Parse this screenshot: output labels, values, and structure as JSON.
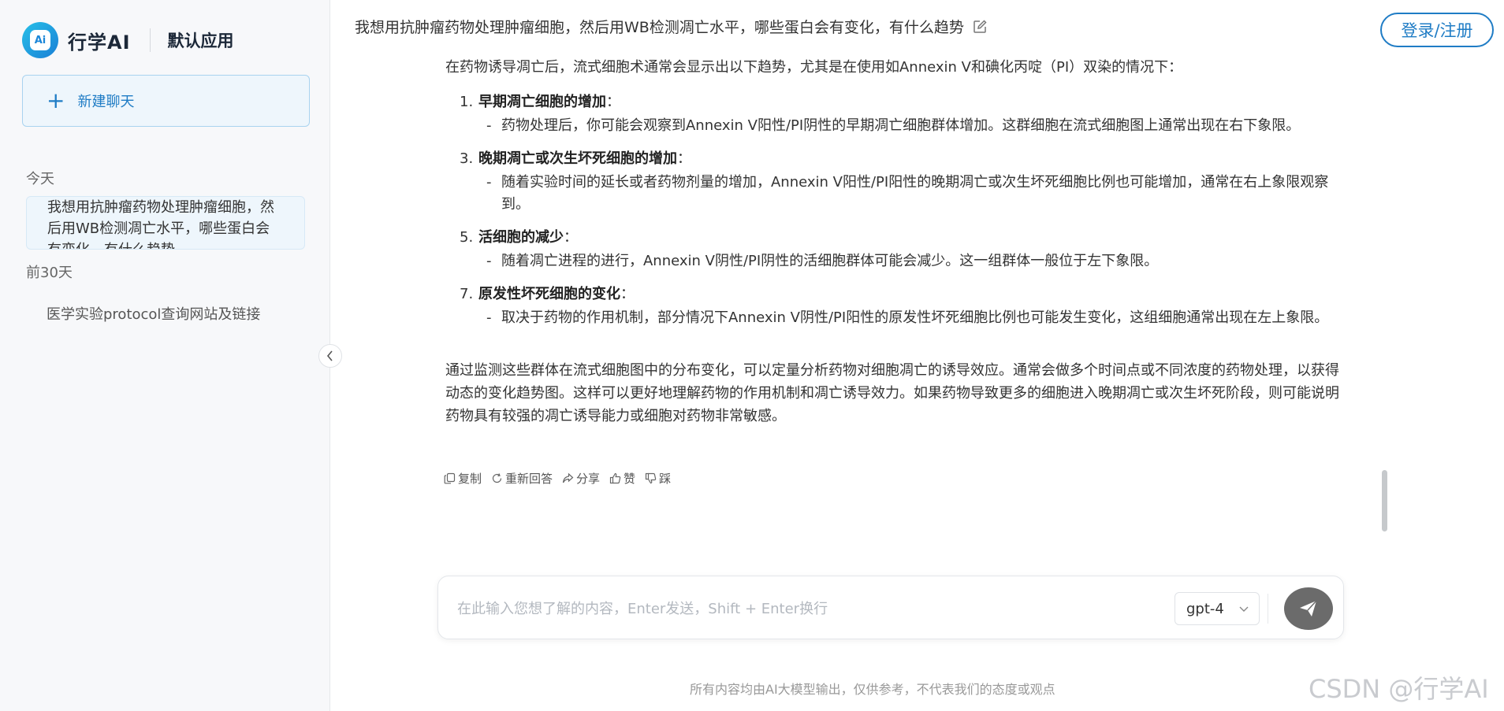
{
  "brand": {
    "logo_text": "Ai",
    "name": "行学AI",
    "app_name": "默认应用"
  },
  "sidebar": {
    "new_chat_label": "新建聊天",
    "groups": [
      {
        "label": "今天",
        "items": [
          "我想用抗肿瘤药物处理肿瘤细胞，然后用WB检测凋亡水平，哪些蛋白会有变化，有什么趋势"
        ]
      },
      {
        "label": "前30天",
        "items": [
          "医学实验protocol查询网站及链接"
        ]
      }
    ]
  },
  "header": {
    "question": "我想用抗肿瘤药物处理肿瘤细胞，然后用WB检测凋亡水平，哪些蛋白会有变化，有什么趋势",
    "login_label": "登录/注册"
  },
  "answer": {
    "intro": "在药物诱导凋亡后，流式细胞术通常会显示出以下趋势，尤其是在使用如Annexin V和碘化丙啶（PI）双染的情况下：",
    "points": [
      {
        "num": "1.",
        "title": "早期凋亡细胞的增加",
        "colon": "：",
        "dash": "-",
        "body": "药物处理后，你可能会观察到Annexin V阳性/PI阴性的早期凋亡细胞群体增加。这群细胞在流式细胞图上通常出现在右下象限。"
      },
      {
        "num": "3.",
        "title": "晚期凋亡或次生坏死细胞的增加",
        "colon": "：",
        "dash": "-",
        "body": "随着实验时间的延长或者药物剂量的增加，Annexin V阳性/PI阳性的晚期凋亡或次生坏死细胞比例也可能增加，通常在右上象限观察到。"
      },
      {
        "num": "5.",
        "title": "活细胞的减少",
        "colon": "：",
        "dash": "-",
        "body": "随着凋亡进程的进行，Annexin V阴性/PI阴性的活细胞群体可能会减少。这一组群体一般位于左下象限。"
      },
      {
        "num": "7.",
        "title": "原发性坏死细胞的变化",
        "colon": "：",
        "dash": "-",
        "body": "取决于药物的作用机制，部分情况下Annexin V阴性/PI阳性的原发性坏死细胞比例也可能发生变化，这组细胞通常出现在左上象限。"
      }
    ],
    "conclusion": "通过监测这些群体在流式细胞图中的分布变化，可以定量分析药物对细胞凋亡的诱导效应。通常会做多个时间点或不同浓度的药物处理，以获得动态的变化趋势图。这样可以更好地理解药物的作用机制和凋亡诱导效力。如果药物导致更多的细胞进入晚期凋亡或次生坏死阶段，则可能说明药物具有较强的凋亡诱导能力或细胞对药物非常敏感。"
  },
  "actions": {
    "copy": "复制",
    "regenerate": "重新回答",
    "share": "分享",
    "like": "赞",
    "dislike": "踩"
  },
  "input": {
    "placeholder": "在此输入您想了解的内容，Enter发送，Shift + Enter换行",
    "model": "gpt-4"
  },
  "footer": {
    "disclaimer": "所有内容均由AI大模型输出，仅供参考，不代表我们的态度或观点",
    "watermark": "CSDN @行学AI"
  },
  "colors": {
    "accent": "#1f7cc5",
    "send_button": "#6b6b6b"
  }
}
